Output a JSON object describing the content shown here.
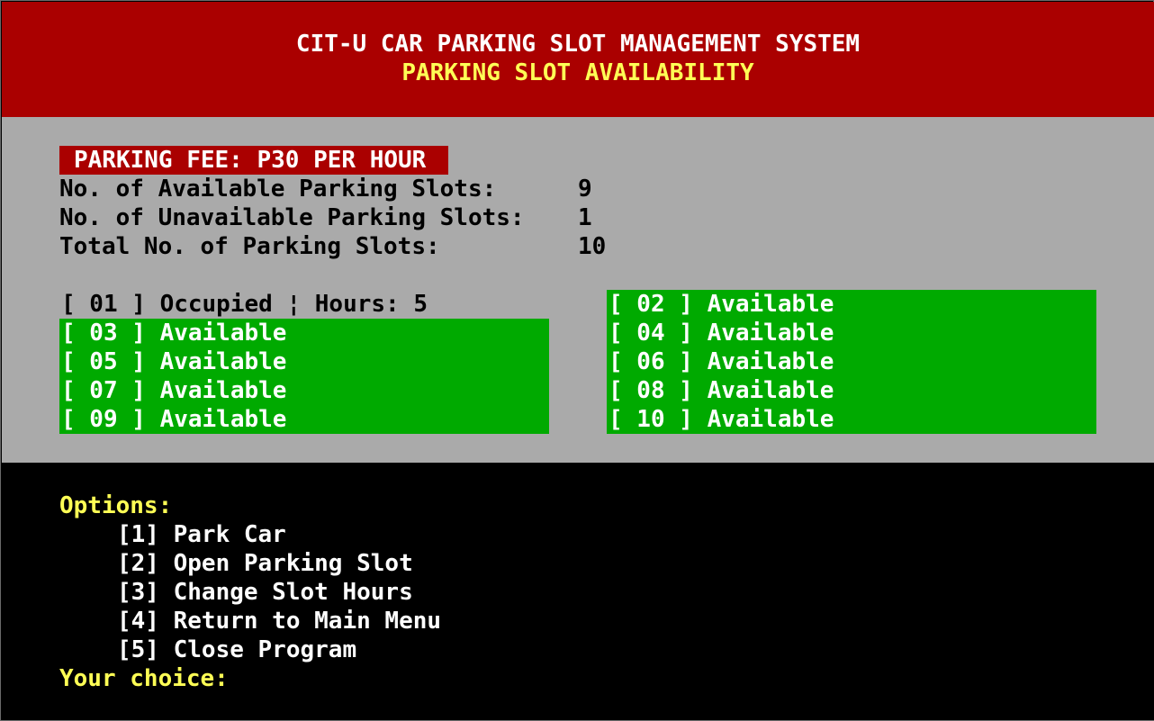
{
  "header": {
    "title": "CIT-U CAR PARKING SLOT MANAGEMENT SYSTEM",
    "subtitle": "PARKING SLOT AVAILABILITY"
  },
  "fee": {
    "label": "PARKING FEE: P30 PER HOUR"
  },
  "stats": {
    "available_label": "No. of Available Parking Slots:",
    "available_value": "9",
    "unavailable_label": "No. of Unavailable Parking Slots:",
    "unavailable_value": "1",
    "total_label": "Total No. of Parking Slots:",
    "total_value": "10"
  },
  "slots": [
    {
      "text": "[ 01 ] Occupied ¦ Hours: 5",
      "status": "occupied"
    },
    {
      "text": "[ 02 ] Available",
      "status": "available"
    },
    {
      "text": "[ 03 ] Available",
      "status": "available"
    },
    {
      "text": "[ 04 ] Available",
      "status": "available"
    },
    {
      "text": "[ 05 ] Available",
      "status": "available"
    },
    {
      "text": "[ 06 ] Available",
      "status": "available"
    },
    {
      "text": "[ 07 ] Available",
      "status": "available"
    },
    {
      "text": "[ 08 ] Available",
      "status": "available"
    },
    {
      "text": "[ 09 ] Available",
      "status": "available"
    },
    {
      "text": "[ 10 ] Available",
      "status": "available"
    }
  ],
  "options": {
    "title": "Options:",
    "items": [
      "[1] Park Car",
      "[2] Open Parking Slot",
      "[3] Change Slot Hours",
      "[4] Return to Main Menu",
      "[5] Close Program"
    ],
    "prompt": "Your choice:"
  },
  "colors": {
    "header_bg": "#aa0000",
    "status_bg": "#aaaaaa",
    "available_bg": "#00aa00",
    "accent_yellow": "#ffff55",
    "options_bg": "#000000"
  }
}
